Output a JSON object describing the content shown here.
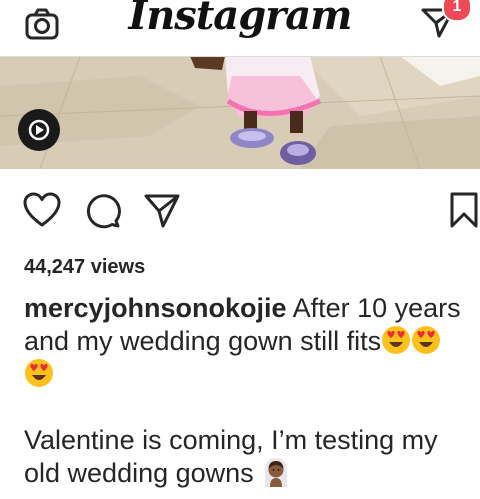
{
  "header": {
    "logo_text": "Instagram",
    "camera_icon": "camera-icon",
    "direct_icon": "paper-plane-icon",
    "notification_count": "1"
  },
  "post": {
    "media_type": "video",
    "play_icon": "play-icon",
    "actions": {
      "like_icon": "heart-icon",
      "comment_icon": "comment-icon",
      "share_icon": "paper-plane-icon",
      "save_icon": "bookmark-icon"
    },
    "views": "44,247 views",
    "username": "mercyjohnsonokojie",
    "caption_line1": " After 10 years and my wedding gown still fits",
    "caption_emojis": [
      "heart-eyes-emoji",
      "heart-eyes-emoji",
      "heart-eyes-emoji"
    ],
    "caption_para2": "Valentine is coming, I’m testing my old wedding gowns ",
    "caption_para2_emoji": "bride-emoji"
  },
  "colors": {
    "badge": "#ed4956",
    "text": "#262626",
    "divider": "#dbdbdb"
  }
}
